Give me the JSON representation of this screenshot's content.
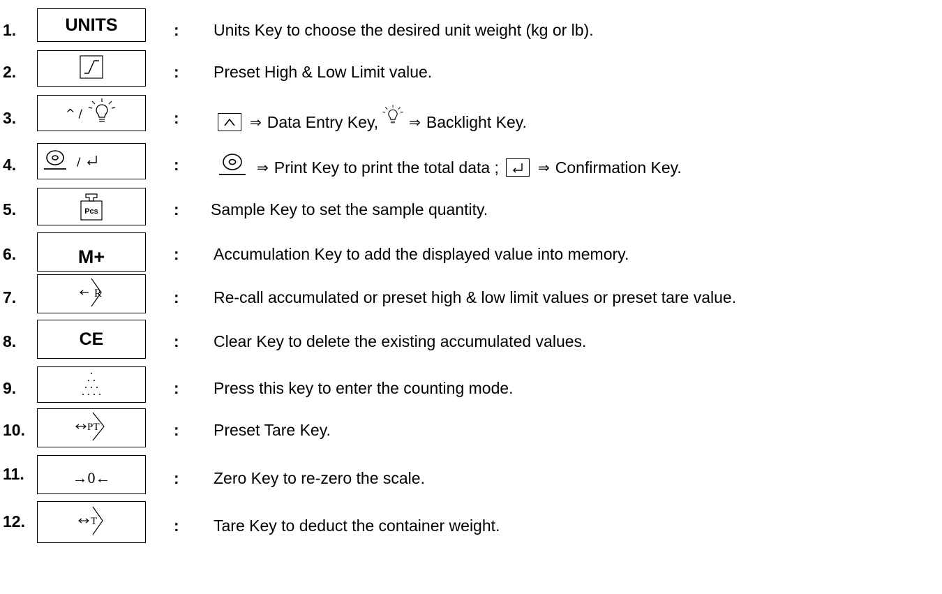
{
  "rows": [
    {
      "num": "1.",
      "key_label": "UNITS",
      "desc": "Units Key to choose the desired unit weight (kg or lb)."
    },
    {
      "num": "2.",
      "desc": "Preset High & Low Limit value."
    },
    {
      "num": "3.",
      "key_label": "^ /",
      "desc_a": "Data Entry Key,",
      "desc_b": "Backlight Key."
    },
    {
      "num": "4.",
      "key_label": "/",
      "desc_a": "Print Key to print the total data ;",
      "desc_b": "Confirmation Key."
    },
    {
      "num": "5.",
      "key_label": "Pcs",
      "desc": "Sample Key to set the sample quantity."
    },
    {
      "num": "6.",
      "key_label": "M+",
      "desc": "Accumulation Key to add the displayed value into memory."
    },
    {
      "num": "7.",
      "key_label": "R",
      "desc": "Re-call accumulated or preset high & low limit values or preset tare value."
    },
    {
      "num": "8.",
      "key_label": "CE",
      "desc": "Clear Key to delete the existing accumulated values."
    },
    {
      "num": "9.",
      "desc": "Press this key to enter the counting mode."
    },
    {
      "num": "10.",
      "key_label": "PT",
      "desc": "Preset Tare Key."
    },
    {
      "num": "11.",
      "key_label": "→0←",
      "desc": "Zero Key to re-zero the scale."
    },
    {
      "num": "12.",
      "key_label": "T",
      "desc": "Tare Key to deduct the container weight."
    }
  ],
  "colon": ":",
  "implies": "⇒",
  "icons": [
    "limit-icon",
    "caret-up-icon",
    "lightbulb-icon",
    "print-icon",
    "enter-icon",
    "sample-weight-icon",
    "recall-icon",
    "counting-dots-icon",
    "preset-tare-icon",
    "zero-icon",
    "tare-icon"
  ]
}
